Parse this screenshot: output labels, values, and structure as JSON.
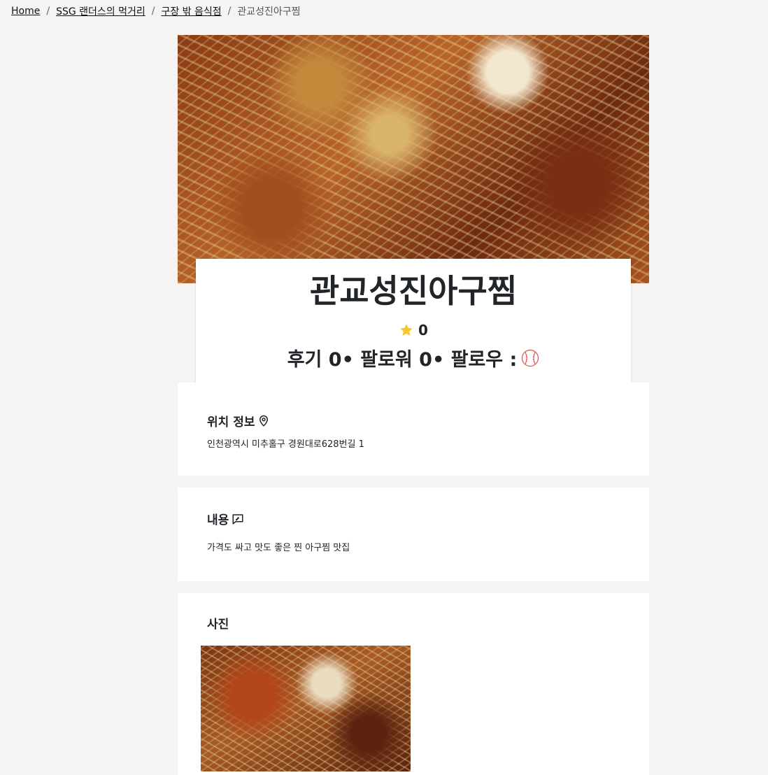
{
  "breadcrumb": {
    "items": [
      "Home",
      "SSG 랜더스의 먹거리",
      "구장 밖 음식점"
    ],
    "current": "관교성진아구찜",
    "separator": "/"
  },
  "restaurant": {
    "name": "관교성진아구찜",
    "rating": "0",
    "stats": {
      "reviews": "후기 0",
      "followers": "• 팔로워 0",
      "following": "• 팔로우 :"
    }
  },
  "location": {
    "heading": "위치 정보",
    "address": "인천광역시 미추홀구 경원대로628번길 1"
  },
  "content": {
    "heading": "내용",
    "text": "가격도 싸고 맛도 좋은 찐 아구찜 맛집"
  },
  "photos": {
    "heading": "사진"
  },
  "icons": {
    "star": "star-icon",
    "baseball": "baseball-icon",
    "location": "map-pin-icon",
    "content": "message-edit-icon"
  },
  "colors": {
    "background": "#f5f4f2",
    "card": "#ffffff",
    "star": "#f7c530",
    "baseball_stitch": "#d9534f"
  }
}
